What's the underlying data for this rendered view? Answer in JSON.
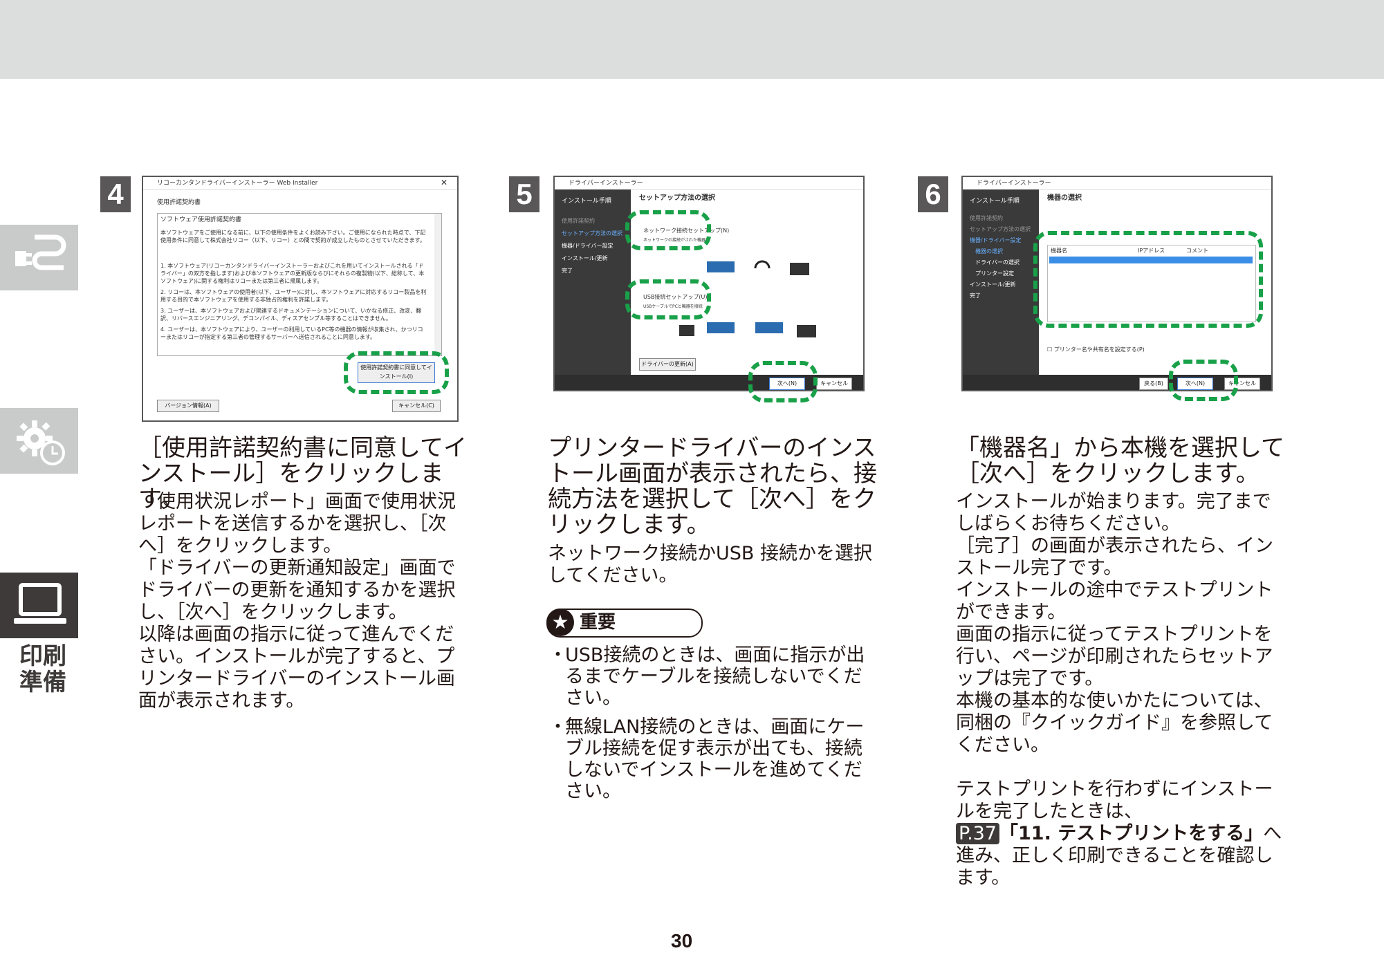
{
  "page_number": "30",
  "sidebar": {
    "label_line1": "印刷",
    "label_line2": "準備"
  },
  "step4": {
    "number": "4",
    "screenshot": {
      "window_title": "リコーカンタンドライバーインストーラー Web Installer",
      "section": "使用許諾契約書",
      "box_title": "ソフトウェア使用許諾契約書",
      "paragraphs": [
        "本ソフトウェアをご使用になる前に、以下の使用条件をよくお読み下さい。ご使用になられた時点で、下記使用条件に同意して株式会社リコー（以下、リコー）との間で契約が成立したものとさせていただきます。",
        "1. 本ソフトウェア(リコーカンタンドライバーインストーラーおよびこれを用いてインストールされる「ドライバー」の双方を指します)および本ソフトウェアの更新版ならびにそれらの複製物(以下、総称して、本ソフトウェア)に関する権利はリコーまたは第三者に帰属します。",
        "2. リコーは、本ソフトウェアの使用者(以下、ユーザー)に対し、本ソフトウェアに対応するリコー製品を利用する目的で本ソフトウェアを使用する非独占的権利を許諾します。",
        "3. ユーザーは、本ソフトウェアおよび関連するドキュメンテーションについて、いかなる修正、改変、翻訳、リバースエンジニアリング、デコンパイル、ディスアセンブル等することはできません。",
        "4. ユーザーは、本ソフトウェアにより、ユーザーの利用しているPC等の機器の情報が収集され、かつリコーまたはリコーが指定する第三者の管理するサーバーへ送信されることに同意します。"
      ],
      "agree_button": "使用許諾契約書に同意してインストール(I)",
      "version_button": "バージョン情報(A)",
      "cancel_button": "キャンセル(C)"
    },
    "title": "［使用許諾契約書に同意してインストール］をクリックします。",
    "body": [
      "「使用状況レポート」画面で使用状況レポートを送信するかを選択し、［次へ］をクリックします。",
      "「ドライバーの更新通知設定」画面でドライバーの更新を通知するかを選択し、［次へ］をクリックします。",
      "以降は画面の指示に従って進んでください。インストールが完了すると、プリンタードライバーのインストール画面が表示されます。"
    ]
  },
  "step5": {
    "number": "5",
    "screenshot": {
      "window_title": "ドライバーインストーラー",
      "nav_heading": "インストール手順",
      "nav_items": [
        "使用許諾契約",
        "セットアップ方法の選択",
        "機器/ドライバー設定",
        "インストール/更新",
        "完了"
      ],
      "main_heading": "セットアップ方法の選択",
      "network_option": "ネットワーク接続セットアップ(N)",
      "network_note": "ネットワークの接続がされた機器を",
      "usb_option": "USB接続セットアップ(U)",
      "usb_note": "USBケーブルでPCと機器を接続",
      "update_button": "ドライバーの更新(A)",
      "next_button": "次へ(N)",
      "cancel_button": "キャンセル(C)"
    },
    "title": "プリンタードライバーのインストール画面が表示されたら、接続方法を選択して［次へ］をクリックします。",
    "body": "ネットワーク接続かUSB 接続かを選択してください。",
    "important": {
      "label": "重要",
      "items": [
        "USB接続のときは、画面に指示が出るまでケーブルを接続しないでください。",
        "無線LAN接続のときは、画面にケーブル接続を促す表示が出ても、接続しないでインストールを進めてください。"
      ]
    }
  },
  "step6": {
    "number": "6",
    "screenshot": {
      "window_title": "ドライバーインストーラー",
      "nav_heading": "インストール手順",
      "nav_items": [
        "使用許諾契約",
        "セットアップ方法の選択",
        "機器/ドライバー設定",
        "機器の選択",
        "ドライバーの選択",
        "プリンター設定",
        "インストール/更新",
        "完了"
      ],
      "main_heading": "機器の選択",
      "columns": [
        "機器名",
        "IPアドレス",
        "コメント"
      ],
      "checkbox_label": "プリンター名や共有名を設定する(P)",
      "back_button": "戻る(B)",
      "next_button": "次へ(N)",
      "cancel_button": "キャンセル(C)"
    },
    "title": "「機器名」から本機を選択して［次へ］をクリックします。",
    "body": [
      "インストールが始まります。完了までしばらくお待ちください。",
      "［完了］の画面が表示されたら、インストール完了です。",
      "インストールの途中でテストプリントができます。",
      "画面の指示に従ってテストプリントを行い、ページが印刷されたらセットアップは完了です。",
      "本機の基本的な使いかたについては、同梱の『クイックガイド』を参照してください。"
    ],
    "note_lead": "テストプリントを行わずにインストールを完了したときは、",
    "ref_page": "P.37",
    "ref_title": "「11. テストプリントをする」",
    "note_tail": "へ進み、正しく印刷できることを確認します。"
  }
}
